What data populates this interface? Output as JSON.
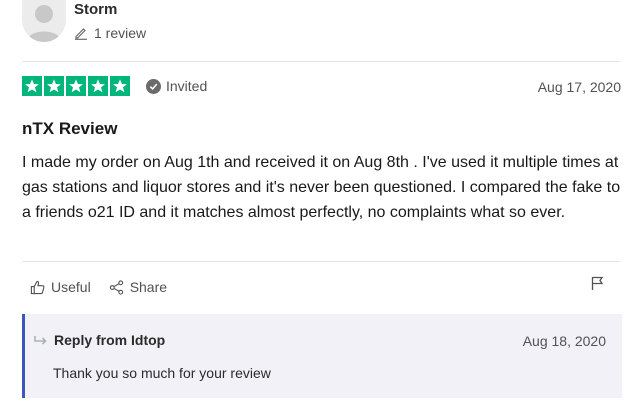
{
  "reviewer": {
    "name": "Storm",
    "review_count": "1 review",
    "avatar_icon": "person-silhouette"
  },
  "review": {
    "rating": 5,
    "max_rating": 5,
    "badge": "Invited",
    "date": "Aug 17, 2020",
    "title": "nTX Review",
    "body": "I made my order on Aug 1th and received it on Aug 8th . I've used it multiple times at gas stations and liquor stores and it's never been questioned. I compared the fake to a friends o21 ID and it matches almost perfectly, no complaints what so ever."
  },
  "actions": {
    "useful_label": "Useful",
    "share_label": "Share",
    "flag_icon": "flag-icon"
  },
  "reply": {
    "title": "Reply from Idtop",
    "date": "Aug 18, 2020",
    "text": "Thank you so much for your review"
  },
  "colors": {
    "star_green": "#00b67a",
    "reply_accent": "#3c57bc",
    "reply_bg": "#f1f1f7"
  }
}
